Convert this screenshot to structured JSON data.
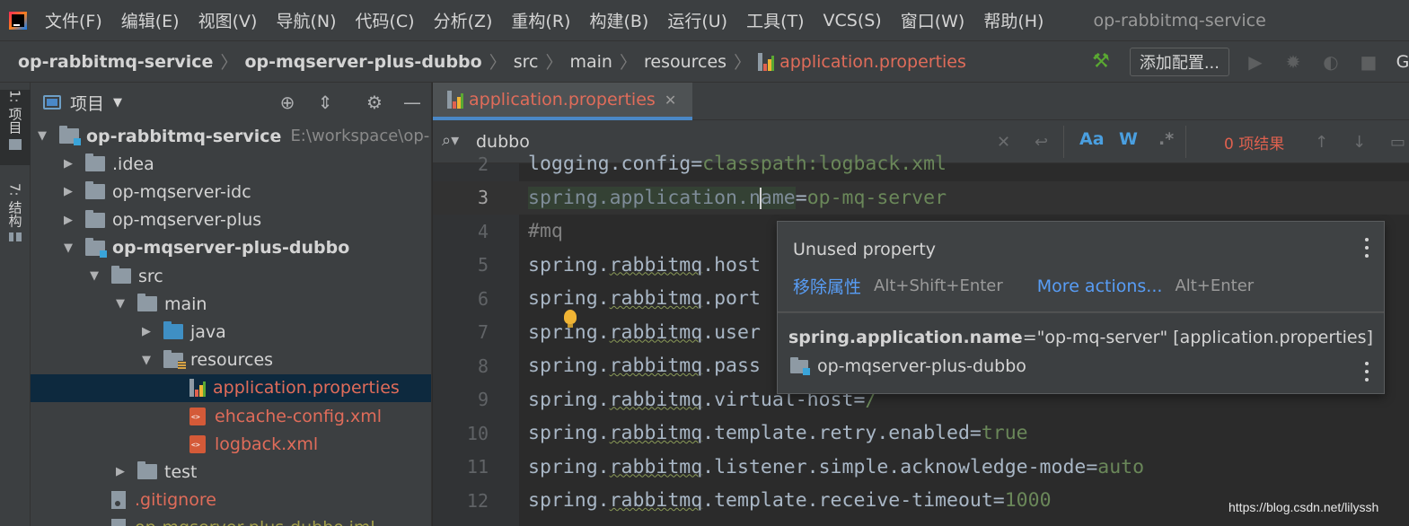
{
  "menubar": {
    "items": [
      "文件(F)",
      "编辑(E)",
      "视图(V)",
      "导航(N)",
      "代码(C)",
      "分析(Z)",
      "重构(R)",
      "构建(B)",
      "运行(U)",
      "工具(T)",
      "VCS(S)",
      "窗口(W)",
      "帮助(H)"
    ],
    "window_title": "op-rabbitmq-service"
  },
  "navbar": {
    "crumbs": [
      "op-rabbitmq-service",
      "op-mqserver-plus-dubbo",
      "src",
      "main",
      "resources",
      "application.properties"
    ],
    "add_config_label": "添加配置...",
    "cut_letter": "G"
  },
  "left_strip": {
    "project_tab": "1: 项目",
    "structure_tab": "7: 结构"
  },
  "project_panel": {
    "title": "项目",
    "tree": [
      {
        "label": "op-rabbitmq-service",
        "path": "E:\\workspace\\op-",
        "level": 0,
        "arrow": "down",
        "type": "module",
        "style": "bold"
      },
      {
        "label": ".idea",
        "level": 1,
        "arrow": "right",
        "type": "folder"
      },
      {
        "label": "op-mqserver-idc",
        "level": 1,
        "arrow": "right",
        "type": "folder"
      },
      {
        "label": "op-mqserver-plus",
        "level": 1,
        "arrow": "right",
        "type": "folder"
      },
      {
        "label": "op-mqserver-plus-dubbo",
        "level": 1,
        "arrow": "down",
        "type": "module",
        "style": "bold"
      },
      {
        "label": "src",
        "level": 2,
        "arrow": "down",
        "type": "folder"
      },
      {
        "label": "main",
        "level": 3,
        "arrow": "down",
        "type": "folder"
      },
      {
        "label": "java",
        "level": 4,
        "arrow": "right",
        "type": "folder-blue"
      },
      {
        "label": "resources",
        "level": 4,
        "arrow": "down",
        "type": "folder-res"
      },
      {
        "label": "application.properties",
        "level": 5,
        "arrow": "none",
        "type": "props",
        "style": "red",
        "selected": true
      },
      {
        "label": "ehcache-config.xml",
        "level": 5,
        "arrow": "none",
        "type": "xml",
        "style": "red"
      },
      {
        "label": "logback.xml",
        "level": 5,
        "arrow": "none",
        "type": "xml",
        "style": "red"
      },
      {
        "label": "test",
        "level": 3,
        "arrow": "right",
        "type": "folder"
      },
      {
        "label": ".gitignore",
        "level": 2,
        "arrow": "none",
        "type": "file",
        "style": "red"
      },
      {
        "label": "op-mqserver-plus-dubbo.iml",
        "level": 2,
        "arrow": "none",
        "type": "file",
        "style": "olive"
      }
    ]
  },
  "editor": {
    "tab_label": "application.properties",
    "find": {
      "query": "dubbo",
      "match_case": "Aa",
      "words": "W",
      "regex": ".*",
      "results": "0 项结果"
    },
    "lines": [
      {
        "n": "2",
        "key": "logging.config",
        "eq": "=",
        "val": "classpath:logback.xml",
        "vclass": "val"
      },
      {
        "n": "3",
        "key_a": "spring.application.n",
        "key_b": "ame",
        "eq": "=",
        "val": "op-mq-server",
        "vclass": "val",
        "current": true
      },
      {
        "n": "4",
        "comment": "#mq"
      },
      {
        "n": "5",
        "pre": "spring.",
        "sq": "rabbitmq",
        "post": ".host"
      },
      {
        "n": "6",
        "pre": "spring.",
        "sq": "rabbitmq",
        "post": ".port"
      },
      {
        "n": "7",
        "pre": "spring.",
        "sq": "rabbitmq",
        "post": ".user"
      },
      {
        "n": "8",
        "pre": "spring.",
        "sq": "rabbitmq",
        "post": ".pass"
      },
      {
        "n": "9",
        "pre": "spring.",
        "sq": "rabbitmq",
        "post": ".virtual-host",
        "eq": "=",
        "val": "/",
        "vclass": "val"
      },
      {
        "n": "10",
        "pre": "spring.",
        "sq": "rabbitmq",
        "post": ".template.retry.enabled",
        "eq": "=",
        "val": "true",
        "vclass": "val"
      },
      {
        "n": "11",
        "pre": "spring.",
        "sq": "rabbitmq",
        "post": ".listener.simple.acknowledge-mode",
        "eq": "=",
        "val": "auto",
        "vclass": "val"
      },
      {
        "n": "12",
        "pre": "spring.",
        "sq": "rabbitmq",
        "post": ".template.receive-timeout",
        "eq": "=",
        "val": "1000",
        "vclass": "val"
      }
    ]
  },
  "popup": {
    "title": "Unused property",
    "action1": "移除属性",
    "action1_key": "Alt+Shift+Enter",
    "action2": "More actions...",
    "action2_key": "Alt+Enter",
    "doc_key": "spring.application.name",
    "doc_rest": "=\"op-mq-server\" [application.properties]",
    "module": "op-mqserver-plus-dubbo"
  },
  "watermark": "https://blog.csdn.net/lilyssh"
}
